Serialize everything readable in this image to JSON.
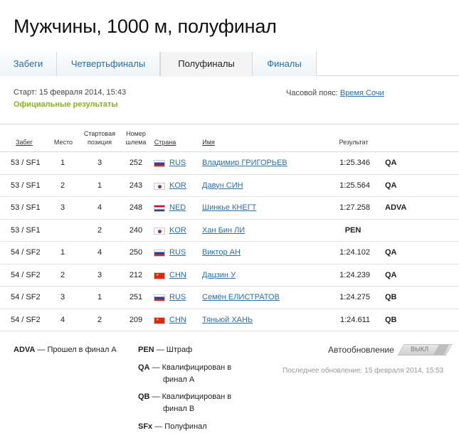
{
  "page": {
    "title": "Мужчины, 1000 м, полуфинал"
  },
  "tabs": [
    {
      "label": "Забеги"
    },
    {
      "label": "Четвертьфиналы"
    },
    {
      "label": "Полуфиналы"
    },
    {
      "label": "Финалы"
    }
  ],
  "meta": {
    "start": "Старт: 15 февраля 2014, 15:43",
    "official": "Официальные результаты",
    "timezone_label": "Часовой пояс:",
    "timezone_link": "Время Сочи"
  },
  "table": {
    "headers": {
      "heat": "Забег",
      "place": "Место",
      "start_pos": "Стартовая позиция",
      "start_pos_l1": "Стартовая",
      "start_pos_l2": "позиция",
      "helmet_l1": "Номер",
      "helmet_l2": "шлема",
      "country": "Страна",
      "name": "Имя",
      "result": "Результат"
    },
    "rows": [
      {
        "heat": "53 / SF1",
        "place": "1",
        "pos": "3",
        "helmet": "252",
        "flag": "rus",
        "country": "RUS",
        "name": "Владимир ГРИГОРЬЕВ",
        "result": "1:25.346",
        "q": "QA"
      },
      {
        "heat": "53 / SF1",
        "place": "2",
        "pos": "1",
        "helmet": "243",
        "flag": "kor",
        "country": "KOR",
        "name": "Давун СИН",
        "result": "1:25.564",
        "q": "QA"
      },
      {
        "heat": "53 / SF1",
        "place": "3",
        "pos": "4",
        "helmet": "248",
        "flag": "ned",
        "country": "NED",
        "name": "Шинкье КНЕГТ",
        "result": "1:27.258",
        "q": "ADVA"
      },
      {
        "heat": "53 / SF1",
        "place": "",
        "pos": "2",
        "helmet": "240",
        "flag": "kor",
        "country": "KOR",
        "name": "Хан Бин ЛИ",
        "result": "PEN",
        "q": ""
      },
      {
        "heat": "54 / SF2",
        "place": "1",
        "pos": "4",
        "helmet": "250",
        "flag": "rus",
        "country": "RUS",
        "name": "Виктор АН",
        "result": "1:24.102",
        "q": "QA"
      },
      {
        "heat": "54 / SF2",
        "place": "2",
        "pos": "3",
        "helmet": "212",
        "flag": "chn",
        "country": "CHN",
        "name": "Дацзин У",
        "result": "1:24.239",
        "q": "QA"
      },
      {
        "heat": "54 / SF2",
        "place": "3",
        "pos": "1",
        "helmet": "251",
        "flag": "rus",
        "country": "RUS",
        "name": "Семён ЕЛИСТРАТОВ",
        "result": "1:24.275",
        "q": "QB"
      },
      {
        "heat": "54 / SF2",
        "place": "4",
        "pos": "2",
        "helmet": "209",
        "flag": "chn",
        "country": "CHN",
        "name": "Тяньюй ХАНЬ",
        "result": "1:24.611",
        "q": "QB"
      }
    ]
  },
  "legend": {
    "adva_code": "ADVA",
    "adva_text": "— Прошел в финал А",
    "pen_code": "PEN",
    "pen_text": "— Штраф",
    "qa_code": "QA",
    "qa_text1": "— Квалифицирован в",
    "qa_text2": "финал А",
    "qb_code": "QB",
    "qb_text1": "— Квалифицирован в",
    "qb_text2": "финал В",
    "sfx_code": "SFx",
    "sfx_text": "— Полуфинал"
  },
  "autoupdate": {
    "label": "Автообновление",
    "toggle_text": "ВЫКЛ",
    "last_update": "Последнее обновление: 15 февраля 2014, 15:53"
  },
  "colors": {
    "link": "#2a6fa8",
    "official": "#8ab024"
  }
}
